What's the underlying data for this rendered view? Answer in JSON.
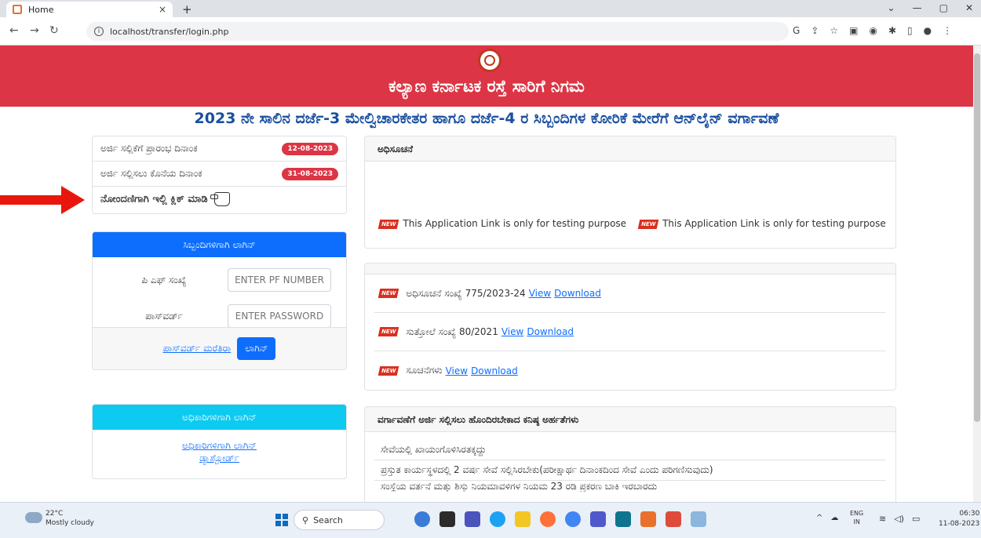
{
  "browser": {
    "tab_title": "Home",
    "new_tab": "+",
    "tab_close": "×",
    "url": "localhost/transfer/login.php"
  },
  "header": {
    "org_name": "ಕಲ್ಯಾಣ ಕರ್ನಾಟಕ ರಸ್ತೆ ಸಾರಿಗೆ ನಿಗಮ",
    "bg_color": "#dc3545"
  },
  "subtitle": "2023 ನೇ ಸಾಲಿನ ದರ್ಜೆ-3 ಮೇಲ್ವಿಚಾರಕೇತರ ಹಾಗೂ ದರ್ಜೆ-4 ರ ಸಿಬ್ಬಂದಿಗಳ ಕೋರಿಕೆ ಮೇರೆಗೆ ಆನ್‌ಲೈನ್ ವರ್ಗಾವಣೆ",
  "dates": {
    "start_label": "ಅರ್ಜಿ ಸಲ್ಲಿಕೆಗೆ ಪ್ರಾರಂಭ ದಿನಾಂಕ",
    "start_date": "12-08-2023",
    "end_label": "ಅರ್ಜಿ ಸಲ್ಲಿಸಲು ಕೊನೆಯ ದಿನಾಂಕ",
    "end_date": "31-08-2023",
    "register_label": "ನೋಂದಣಿಗಾಗಿ ಇಲ್ಲಿ ಕ್ಲಿಕ್ ಮಾಡಿ"
  },
  "staff_login": {
    "heading": "ಸಿಬ್ಬಂದಿಗಳಿಗಾಗಿ ಲಾಗಿನ್",
    "pf_label": "ಪಿ ಎಫ್ ಸಂಖ್ಯೆ",
    "pf_placeholder": "ENTER PF NUMBER",
    "password_label": "ಪಾಸ್‌ವರ್ಡ್",
    "password_placeholder": "ENTER PASSWORD",
    "forgot_link": "ಪಾಸ್‌ವರ್ಡ್ ಮರೆತಿರಾ",
    "login_button": "ಲಾಗಿನ್"
  },
  "officer_login": {
    "heading": "ಅಧಿಕಾರಿಗಳಿಗಾಗಿ ಲಾಗಿನ್",
    "link_line1": "ಅಧಿಕಾರಿಗಳಿಗಾಗಿ ಲಾಗಿನ್",
    "link_line2": "ಡ್ಯಾಶ್ಬೋರ್ಡ್"
  },
  "notification": {
    "heading": "ಅಧಿಸೂಚನೆ",
    "badge": "NEW",
    "message": "This Application Link is only for testing purpose"
  },
  "documents": [
    {
      "badge": "NEW",
      "text": "ಅಧಿಸೂಚನೆ ಸಂಖ್ಯೆ 775/2023-24",
      "view": "View",
      "download": "Download"
    },
    {
      "badge": "NEW",
      "text": "ಸುತ್ತೋಲೆ ಸಂಖ್ಯೆ 80/2021",
      "view": "View",
      "download": "Download"
    },
    {
      "badge": "NEW",
      "text": "ಸೂಚನೆಗಳು",
      "view": "View",
      "download": "Download"
    }
  ],
  "qualifications": {
    "heading": "ವರ್ಗಾವಣೆಗೆ ಅರ್ಜಿ ಸಲ್ಲಿಸಲು ಹೊಂದಿರಬೇಕಾದ ಕನಿಷ್ಠ ಅರ್ಹತೆಗಳು",
    "items": [
      "ಸೇವೆಯಲ್ಲಿ ಖಾಯಂಗೊಳಿಸಿರತಕ್ಕದ್ದು",
      "ಪ್ರಸ್ತುತ ಕಾರ್ಯಸ್ಥಳದಲ್ಲಿ 2 ವರ್ಷ ಸೇವೆ ಸಲ್ಲಿಸಿರಬೇಕು(ಪರೀಕ್ಷಾರ್ಥ ದಿನಾಂಕದಿಂದ ಸೇವೆ ಎಂದು ಪರಿಗಣಿಸುವುದು)",
      "ಸಂಸ್ಥೆಯ ವರ್ತನೆ ಮತ್ತು ಶಿಸ್ತು ನಿಯಮಾವಳಿಗಳ ನಿಯಮ 23 ರಡಿ ಪ್ರಕರಣ ಬಾಕಿ ಇರಬಾರದು"
    ]
  },
  "taskbar": {
    "temperature": "22°C",
    "weather": "Mostly cloudy",
    "search": "Search",
    "lang1": "ENG",
    "lang2": "IN",
    "time": "06:30",
    "date": "11-08-2023"
  }
}
